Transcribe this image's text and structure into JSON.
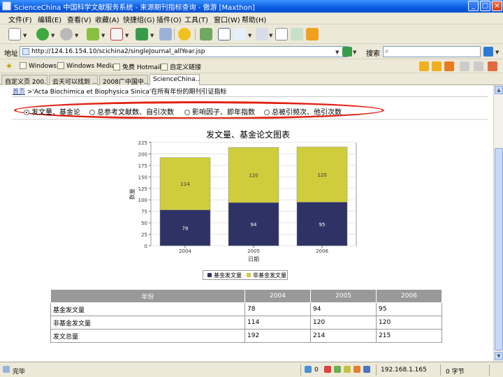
{
  "window": {
    "title": "ScienceChina 中国科学文献服务系统 - 来源期刊指标查询 - 傲游 [Maxthon]",
    "min": "_",
    "max": "□",
    "close": "×"
  },
  "menu": [
    "文件(F)",
    "编辑(E)",
    "查看(V)",
    "收藏(A)",
    "快捷组(G)",
    "插件(O)",
    "工具(T)",
    "窗口(W)",
    "帮助(H)"
  ],
  "address": {
    "label": "地址",
    "url": "http://124.16.154.10/scichina2/singleJournal_allYear.jsp",
    "search_label": "搜索"
  },
  "links": [
    "Windows",
    "Windows Media",
    "免费 Hotmail",
    "自定义链接"
  ],
  "tabs": [
    "自定义页 200...",
    "云天可以找到 ...",
    "2008广中国中...",
    "ScienceChina..."
  ],
  "breadcrumb": {
    "home": "首页",
    "rest": ">'Acta Biochimica et Biophysica Sinica'在所有年份的期刊引证指标"
  },
  "options": [
    {
      "label": "发文量、基金论",
      "selected": true
    },
    {
      "label": "总参考文献数、自引次数",
      "selected": false
    },
    {
      "label": "影响因子、即年指数",
      "selected": false
    },
    {
      "label": "总被引频次、他引次数",
      "selected": false
    }
  ],
  "chart_data": {
    "type": "bar",
    "stacked": true,
    "title": "发文量、基金论文图表",
    "xlabel": "日期",
    "ylabel": "数量",
    "categories": [
      "2004",
      "2005",
      "2006"
    ],
    "series": [
      {
        "name": "基金发文量",
        "values": [
          78,
          94,
          95
        ],
        "color": "#2f3265"
      },
      {
        "name": "非基金发文量",
        "values": [
          114,
          120,
          120
        ],
        "color": "#cfcd3c"
      }
    ],
    "ylim": [
      0,
      225
    ],
    "yticks": [
      "0",
      "25",
      "50",
      "75",
      "100",
      "125",
      "150",
      "175",
      "200",
      "225"
    ],
    "grid": true,
    "legend_position": "bottom"
  },
  "table": {
    "headers": [
      "年份",
      "2004",
      "2005",
      "2006"
    ],
    "rows": [
      [
        "基金发文量",
        "78",
        "94",
        "95"
      ],
      [
        "非基金发文量",
        "114",
        "120",
        "120"
      ],
      [
        "发文总量",
        "192",
        "214",
        "215"
      ]
    ]
  },
  "status": {
    "left": "完毕",
    "count": "0",
    "ip": "192.168.1.165",
    "speed": "0 字节"
  }
}
